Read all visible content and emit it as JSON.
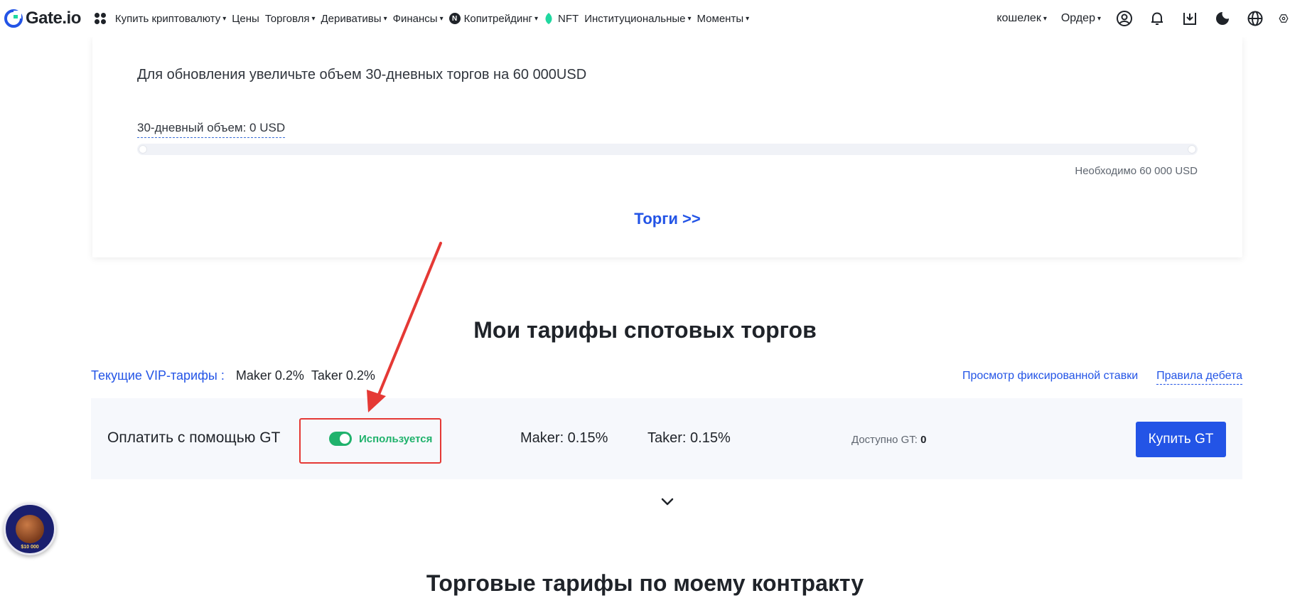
{
  "brand": {
    "name": "Gate.io"
  },
  "nav": {
    "items": [
      {
        "label": "Купить криптовалюту",
        "dropdown": true
      },
      {
        "label": "Цены",
        "dropdown": false
      },
      {
        "label": "Торговля",
        "dropdown": true
      },
      {
        "label": "Деривативы",
        "dropdown": true
      },
      {
        "label": "Финансы",
        "dropdown": true
      },
      {
        "label": "Копитрейдинг",
        "dropdown": true
      },
      {
        "label": "NFT",
        "dropdown": false
      },
      {
        "label": "Институциональные",
        "dropdown": true
      },
      {
        "label": "Моменты",
        "dropdown": true
      }
    ],
    "right": {
      "wallet": "кошелек",
      "order": "Ордер"
    },
    "caret": "▾"
  },
  "vip_card": {
    "upgrade_text": "Для обновления увеличьте объем 30-дневных торгов на 60 000USD",
    "volume_label": "30-дневный объем: 0 USD",
    "progress_percent": 0,
    "needed_text": "Необходимо 60 000 USD",
    "trade_link": "Торги >>"
  },
  "spot_fees": {
    "title": "Мои тарифы спотовых торгов",
    "vip_label": "Текущие VIP-тарифы :",
    "vip_maker": "Maker 0.2%",
    "vip_taker": "Taker 0.2%",
    "link_fixed_rate": "Просмотр фиксированной ставки",
    "link_debit_rules": "Правила дебета",
    "gt_row": {
      "pay_label": "Оплатить с помощью GT",
      "toggle_on": true,
      "toggle_label": "Используется",
      "maker": "Maker: 0.15%",
      "taker": "Taker: 0.15%",
      "available_label": "Доступно GT:",
      "available_value": "0",
      "buy_button": "Купить GT"
    }
  },
  "contract_fees": {
    "title": "Торговые тарифы по моему контракту"
  },
  "badge": {
    "text": "$10 000"
  },
  "colors": {
    "accent_blue": "#2354e6",
    "toggle_green": "#20b26c",
    "annotation_red": "#e53935"
  }
}
